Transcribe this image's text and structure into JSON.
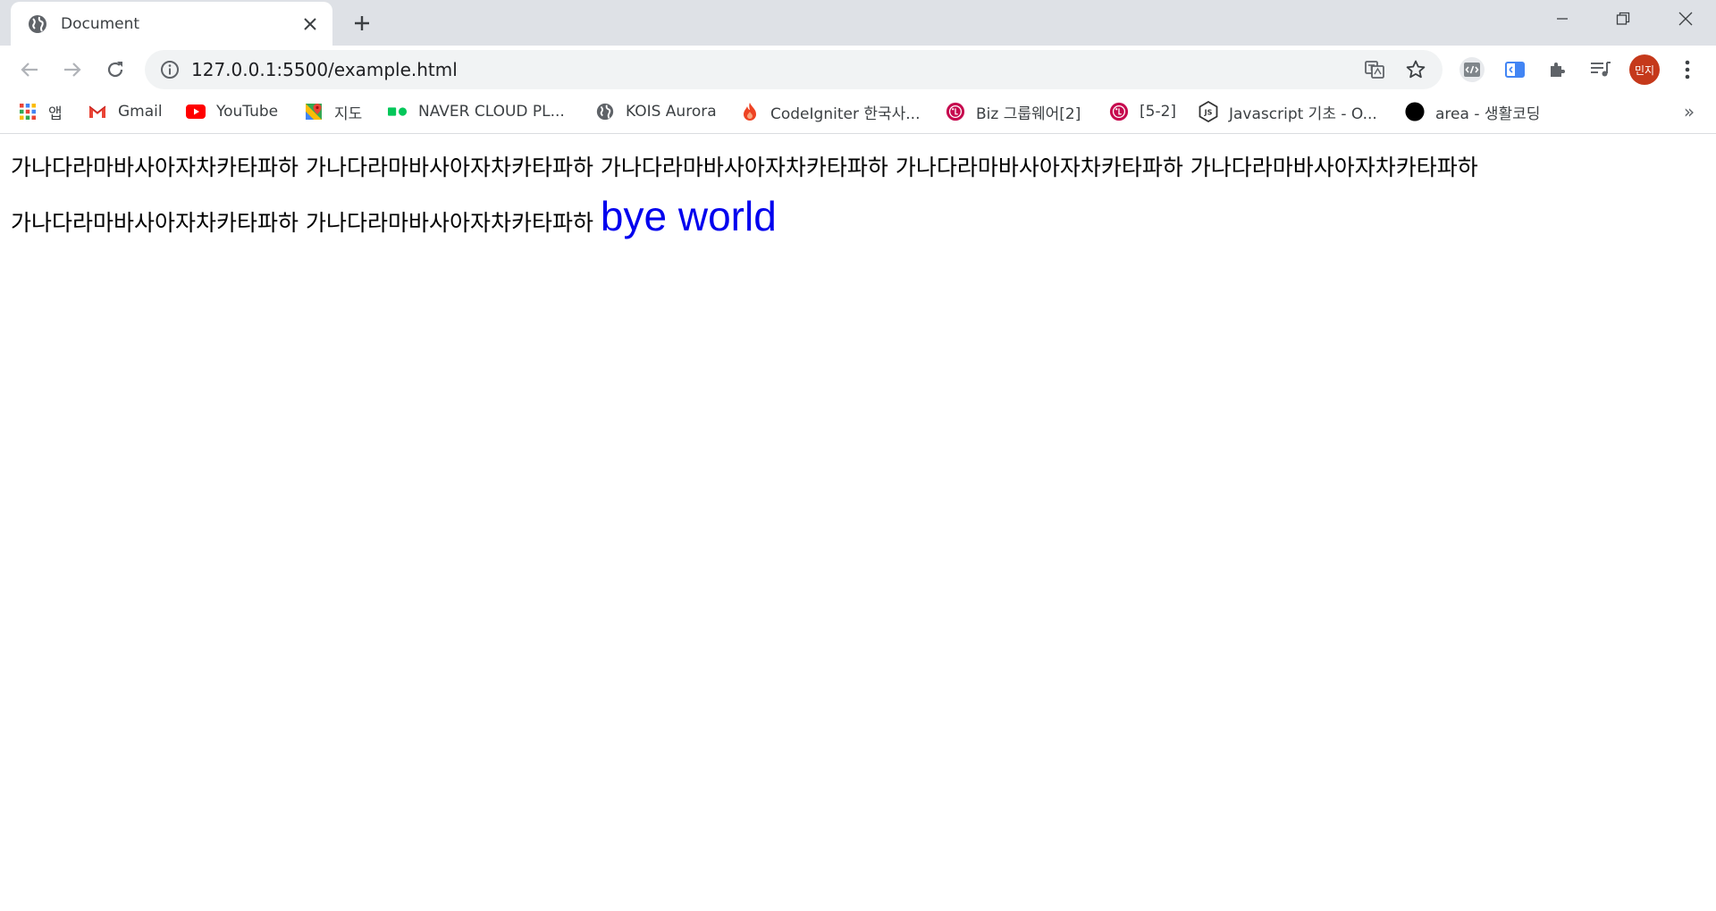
{
  "tab": {
    "title": "Document",
    "favicon": "globe-icon"
  },
  "window_controls": [
    "minimize-icon",
    "restore-icon",
    "close-icon"
  ],
  "toolbar": {
    "back": "back-arrow-icon",
    "forward": "forward-arrow-icon",
    "reload": "reload-icon",
    "url": "127.0.0.1:5500/example.html",
    "profile_label": "민지",
    "profile_color": "#c5391b"
  },
  "bookmarks": {
    "items": [
      {
        "label": "앱",
        "icon": "apps-grid-icon"
      },
      {
        "label": "Gmail",
        "icon": "gmail-icon"
      },
      {
        "label": "YouTube",
        "icon": "youtube-icon"
      },
      {
        "label": "지도",
        "icon": "maps-icon"
      },
      {
        "label": "NAVER CLOUD PL...",
        "icon": "naver-cloud-icon"
      },
      {
        "label": "KOIS Aurora",
        "icon": "globe-icon"
      },
      {
        "label": "CodeIgniter 한국사...",
        "icon": "codeigniter-flame-icon"
      },
      {
        "label": "Biz 그룹웨어[2]",
        "icon": "lg-icon"
      },
      {
        "label": "[5-2]",
        "icon": "lg-icon"
      },
      {
        "label": "Javascript 기초 - O...",
        "icon": "nodejs-icon"
      },
      {
        "label": "area - 생활코딩",
        "icon": "black-circle-icon"
      }
    ],
    "overflow": "»"
  },
  "page": {
    "paragraph": "가나다라마바사아자차카타파하 가나다라마바사아자차카타파하 가나다라마바사아자차카타파하 가나다라마바사아자차카타파하 가나다라마바사아자차카타파하 가나다라마바사아자차카타파하 가나다라마바사아자차카타파하",
    "highlight": "bye world",
    "highlight_color": "#0000ee"
  }
}
